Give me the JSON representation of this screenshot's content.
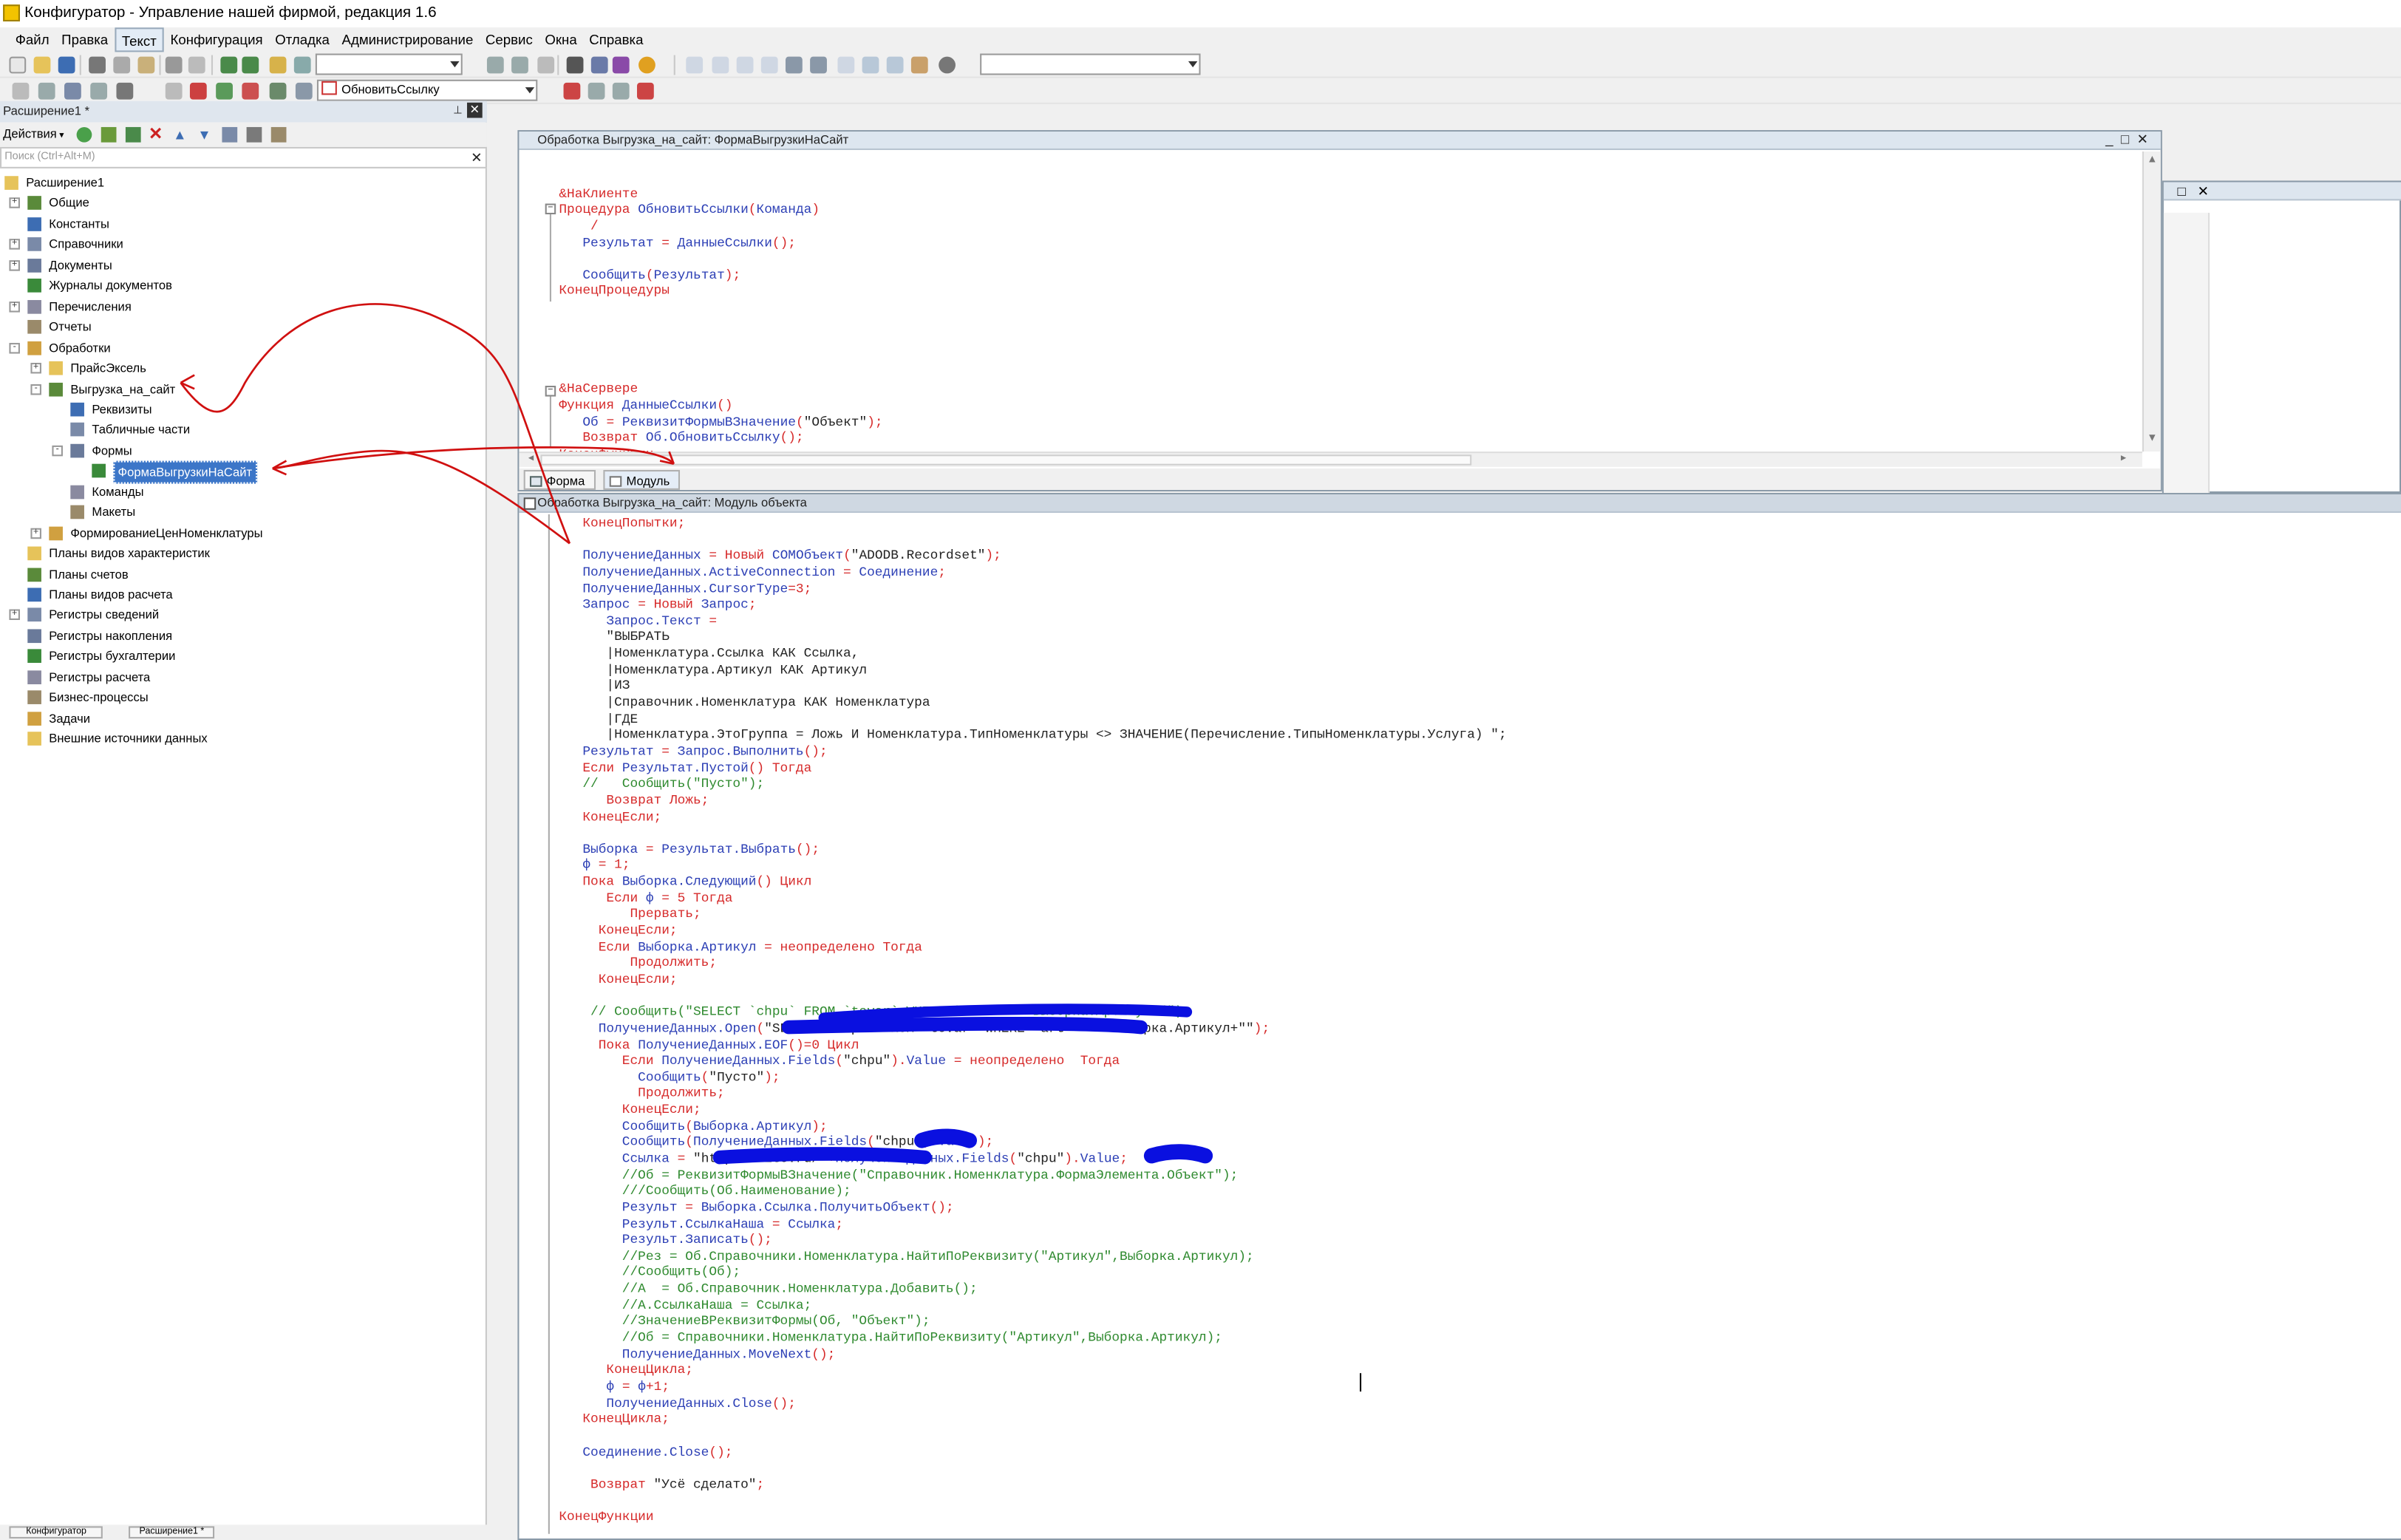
{
  "app": {
    "title": "Конфигуратор - Управление нашей фирмой, редакция 1.6",
    "window_controls": "_ □ ✕"
  },
  "menu": [
    "Файл",
    "Правка",
    "Текст",
    "Конфигурация",
    "Отладка",
    "Администрирование",
    "Сервис",
    "Окна",
    "Справка"
  ],
  "toolbar": {
    "proc_combo_value": "ОбновитьСсылку"
  },
  "panel": {
    "title": "Расширение1 *",
    "actions_label": "Действия",
    "search_placeholder": "Поиск (Ctrl+Alt+M)",
    "tree": [
      {
        "label": "Расширение1",
        "level": 0,
        "exp": "",
        "icon": "extension-icon"
      },
      {
        "label": "Общие",
        "level": 1,
        "exp": "+",
        "icon": "common-icon"
      },
      {
        "label": "Константы",
        "level": 1,
        "exp": "",
        "icon": "constants-icon"
      },
      {
        "label": "Справочники",
        "level": 1,
        "exp": "+",
        "icon": "catalogs-icon"
      },
      {
        "label": "Документы",
        "level": 1,
        "exp": "+",
        "icon": "documents-icon"
      },
      {
        "label": "Журналы документов",
        "level": 1,
        "exp": "",
        "icon": "journals-icon"
      },
      {
        "label": "Перечисления",
        "level": 1,
        "exp": "+",
        "icon": "enums-icon"
      },
      {
        "label": "Отчеты",
        "level": 1,
        "exp": "",
        "icon": "reports-icon"
      },
      {
        "label": "Обработки",
        "level": 1,
        "exp": "-",
        "icon": "processings-icon"
      },
      {
        "label": "ПрайсЭксель",
        "level": 2,
        "exp": "+",
        "icon": "processing-icon"
      },
      {
        "label": "Выгрузка_на_сайт",
        "level": 2,
        "exp": "-",
        "icon": "processing-icon"
      },
      {
        "label": "Реквизиты",
        "level": 3,
        "exp": "",
        "icon": "attributes-icon"
      },
      {
        "label": "Табличные части",
        "level": 3,
        "exp": "",
        "icon": "tabular-icon"
      },
      {
        "label": "Формы",
        "level": 3,
        "exp": "-",
        "icon": "forms-icon"
      },
      {
        "label": "ФормаВыгрузкиНаСайт",
        "level": 4,
        "exp": "",
        "icon": "form-icon",
        "selected": true
      },
      {
        "label": "Команды",
        "level": 3,
        "exp": "",
        "icon": "commands-icon"
      },
      {
        "label": "Макеты",
        "level": 3,
        "exp": "",
        "icon": "templates-icon"
      },
      {
        "label": "ФормированиеЦенНоменклатуры",
        "level": 2,
        "exp": "+",
        "icon": "processing-icon"
      },
      {
        "label": "Планы видов характеристик",
        "level": 1,
        "exp": "",
        "icon": "chart-types-icon"
      },
      {
        "label": "Планы счетов",
        "level": 1,
        "exp": "",
        "icon": "accounts-icon"
      },
      {
        "label": "Планы видов расчета",
        "level": 1,
        "exp": "",
        "icon": "calc-types-icon"
      },
      {
        "label": "Регистры сведений",
        "level": 1,
        "exp": "+",
        "icon": "info-reg-icon"
      },
      {
        "label": "Регистры накопления",
        "level": 1,
        "exp": "",
        "icon": "accum-reg-icon"
      },
      {
        "label": "Регистры бухгалтерии",
        "level": 1,
        "exp": "",
        "icon": "acc-reg-icon"
      },
      {
        "label": "Регистры расчета",
        "level": 1,
        "exp": "",
        "icon": "calc-reg-icon"
      },
      {
        "label": "Бизнес-процессы",
        "level": 1,
        "exp": "",
        "icon": "bp-icon"
      },
      {
        "label": "Задачи",
        "level": 1,
        "exp": "",
        "icon": "tasks-icon"
      },
      {
        "label": "Внешние источники данных",
        "level": 1,
        "exp": "",
        "icon": "ext-sources-icon"
      }
    ]
  },
  "form_window": {
    "title": "Обработка Выгрузка_на_сайт: ФормаВыгрузкиНаСайт",
    "tabs": [
      "Форма",
      "Модуль"
    ],
    "lines": [
      [],
      [
        [
          "k",
          "&НаКлиенте"
        ]
      ],
      [
        [
          "k",
          "Процедура "
        ],
        [
          "i",
          "ОбновитьСсылки"
        ],
        [
          "k",
          "("
        ],
        [
          "i",
          "Команда"
        ],
        [
          "k",
          ")"
        ]
      ],
      [
        [
          "k",
          "    /"
        ]
      ],
      [
        [
          "i",
          "   Результат "
        ],
        [
          "k",
          "= "
        ],
        [
          "i",
          "ДанныеСсылки"
        ],
        [
          "k",
          "();"
        ]
      ],
      [],
      [
        [
          "i",
          "   Сообщить"
        ],
        [
          "k",
          "("
        ],
        [
          "i",
          "Результат"
        ],
        [
          "k",
          ");"
        ]
      ],
      [
        [
          "k",
          "КонецПроцедуры"
        ]
      ],
      [],
      [],
      [],
      [],
      [],
      [
        [
          "k",
          "&НаСервере"
        ]
      ],
      [
        [
          "k",
          "Функция "
        ],
        [
          "i",
          "ДанныеСсылки"
        ],
        [
          "k",
          "()"
        ]
      ],
      [
        [
          "i",
          "   Об "
        ],
        [
          "k",
          "= "
        ],
        [
          "i",
          "РеквизитФормыВЗначение"
        ],
        [
          "k",
          "("
        ],
        [
          "s",
          "\"Объект\""
        ],
        [
          "k",
          ");"
        ]
      ],
      [
        [
          "k",
          "   Возврат "
        ],
        [
          "i",
          "Об.ОбновитьСсылку"
        ],
        [
          "k",
          "();"
        ]
      ],
      [
        [
          "k",
          "КонецФункции"
        ]
      ]
    ]
  },
  "module_window": {
    "title": "Обработка Выгрузка_на_сайт: Модуль объекта",
    "lines": [
      [
        [
          "k",
          "   КонецПопытки;"
        ]
      ],
      [],
      [
        [
          "i",
          "   ПолучениеДанных "
        ],
        [
          "k",
          "= Новый "
        ],
        [
          "i",
          "COMОбъект"
        ],
        [
          "k",
          "("
        ],
        [
          "s",
          "\"ADODB.Recordset\""
        ],
        [
          "k",
          ");"
        ]
      ],
      [
        [
          "i",
          "   ПолучениеДанных.ActiveConnection "
        ],
        [
          "k",
          "= "
        ],
        [
          "i",
          "Соединение"
        ],
        [
          "k",
          ";"
        ]
      ],
      [
        [
          "i",
          "   ПолучениеДанных.CursorType"
        ],
        [
          "k",
          "=3;"
        ]
      ],
      [
        [
          "i",
          "   Запрос "
        ],
        [
          "k",
          "= Новый "
        ],
        [
          "i",
          "Запрос"
        ],
        [
          "k",
          ";"
        ]
      ],
      [
        [
          "i",
          "      Запрос.Текст "
        ],
        [
          "k",
          "="
        ]
      ],
      [
        [
          "s",
          "      \"ВЫБРАТЬ"
        ]
      ],
      [
        [
          "s",
          "      |Номенклатура.Ссылка КАК Ссылка,"
        ]
      ],
      [
        [
          "s",
          "      |Номенклатура.Артикул КАК Артикул"
        ]
      ],
      [
        [
          "s",
          "      |ИЗ"
        ]
      ],
      [
        [
          "s",
          "      |Справочник.Номенклатура КАК Номенклатура"
        ]
      ],
      [
        [
          "s",
          "      |ГДЕ"
        ]
      ],
      [
        [
          "s",
          "      |Номенклатура.ЭтоГруппа = Ложь И Номенклатура.ТипНоменклатуры <> ЗНАЧЕНИЕ(Перечисление.ТипыНоменклатуры.Услуга) \";"
        ]
      ],
      [
        [
          "i",
          "   Результат "
        ],
        [
          "k",
          "= "
        ],
        [
          "i",
          "Запрос.Выполнить"
        ],
        [
          "k",
          "();"
        ]
      ],
      [
        [
          "k",
          "   Если "
        ],
        [
          "i",
          "Результат.Пустой"
        ],
        [
          "k",
          "() Тогда"
        ]
      ],
      [
        [
          "c",
          "   //   Сообщить(\"Пусто\");"
        ]
      ],
      [
        [
          "k",
          "      Возврат Ложь;"
        ]
      ],
      [
        [
          "k",
          "   КонецЕсли;"
        ]
      ],
      [],
      [
        [
          "i",
          "   Выборка "
        ],
        [
          "k",
          "= "
        ],
        [
          "i",
          "Результат.Выбрать"
        ],
        [
          "k",
          "();"
        ]
      ],
      [
        [
          "i",
          "   ф "
        ],
        [
          "k",
          "= 1;"
        ]
      ],
      [
        [
          "k",
          "   Пока "
        ],
        [
          "i",
          "Выборка.Следующий"
        ],
        [
          "k",
          "() Цикл"
        ]
      ],
      [
        [
          "k",
          "      Если "
        ],
        [
          "i",
          "ф "
        ],
        [
          "k",
          "= 5 Тогда"
        ]
      ],
      [
        [
          "k",
          "         Прервать;"
        ]
      ],
      [
        [
          "k",
          "     КонецЕсли;"
        ]
      ],
      [
        [
          "k",
          "     Если "
        ],
        [
          "i",
          "Выборка.Артикул "
        ],
        [
          "k",
          "= неопределено Тогда"
        ]
      ],
      [
        [
          "k",
          "         Продолжить;"
        ]
      ],
      [
        [
          "k",
          "     КонецЕсли;"
        ]
      ],
      [],
      [
        [
          "c",
          "    // Сообщить(\"SELECT `chpu` FROM `tovar` WHERE `art` = \"+Выборка.Артикул+\"\");"
        ]
      ],
      [
        [
          "i",
          "     ПолучениеДанных.Open"
        ],
        [
          "k",
          "("
        ],
        [
          "s",
          "\"SELECT `chpu` FROM `tovar` WHERE `art` = \"+Выборка.Артикул+\"\""
        ],
        [
          "k",
          ");"
        ]
      ],
      [
        [
          "k",
          "     Пока "
        ],
        [
          "i",
          "ПолучениеДанных.EOF"
        ],
        [
          "k",
          "()=0 Цикл"
        ]
      ],
      [
        [
          "k",
          "        Если "
        ],
        [
          "i",
          "ПолучениеДанных.Fields"
        ],
        [
          "k",
          "("
        ],
        [
          "s",
          "\"chpu\""
        ],
        [
          "k",
          ")."
        ],
        [
          "i",
          "Value "
        ],
        [
          "k",
          "= неопределено  Тогда"
        ]
      ],
      [
        [
          "i",
          "          Сообщить"
        ],
        [
          "k",
          "("
        ],
        [
          "s",
          "\"Пусто\""
        ],
        [
          "k",
          ");"
        ]
      ],
      [
        [
          "k",
          "          Продолжить;"
        ]
      ],
      [
        [
          "k",
          "        КонецЕсли;"
        ]
      ],
      [
        [
          "i",
          "        Сообщить"
        ],
        [
          "k",
          "("
        ],
        [
          "i",
          "Выборка.Артикул"
        ],
        [
          "k",
          ");"
        ]
      ],
      [
        [
          "i",
          "        Сообщить"
        ],
        [
          "k",
          "("
        ],
        [
          "i",
          "ПолучениеДанных.Fields"
        ],
        [
          "k",
          "("
        ],
        [
          "s",
          "\"chpu\""
        ],
        [
          "k",
          ")."
        ],
        [
          "i",
          "Value"
        ],
        [
          "k",
          ");"
        ]
      ],
      [
        [
          "i",
          "        Ссылка "
        ],
        [
          "k",
          "= "
        ],
        [
          "s",
          "\"http://site.ru/\""
        ],
        [
          "k",
          "+"
        ],
        [
          "i",
          "ПолучениеДанных.Fields"
        ],
        [
          "k",
          "("
        ],
        [
          "s",
          "\"chpu\""
        ],
        [
          "k",
          ")."
        ],
        [
          "i",
          "Value"
        ],
        [
          "k",
          ";"
        ]
      ],
      [
        [
          "c",
          "        //Об = РеквизитФормыВЗначение(\"Справочник.Номенклатура.ФормаЭлемента.Объект\");"
        ]
      ],
      [
        [
          "c",
          "        ///Сообщить(Об.Наименование);"
        ]
      ],
      [
        [
          "i",
          "        Результ "
        ],
        [
          "k",
          "= "
        ],
        [
          "i",
          "Выборка.Ссылка.ПолучитьОбъект"
        ],
        [
          "k",
          "();"
        ]
      ],
      [
        [
          "i",
          "        Результ.СсылкаНаша "
        ],
        [
          "k",
          "= "
        ],
        [
          "i",
          "Ссылка"
        ],
        [
          "k",
          ";"
        ]
      ],
      [
        [
          "i",
          "        Результ.Записать"
        ],
        [
          "k",
          "();"
        ]
      ],
      [
        [
          "c",
          "        //Рез = Об.Справочники.Номенклатура.НайтиПоРеквизиту(\"Артикул\",Выборка.Артикул);"
        ]
      ],
      [
        [
          "c",
          "        //Сообщить(Об);"
        ]
      ],
      [
        [
          "c",
          "        //А  = Об.Справочник.Номенклатура.Добавить();"
        ]
      ],
      [
        [
          "c",
          "        //А.СсылкаНаша = Ссылка;"
        ]
      ],
      [
        [
          "c",
          "        //ЗначениеВРеквизитФормы(Об, \"Объект\");"
        ]
      ],
      [
        [
          "c",
          "        //Об = Справочники.Номенклатура.НайтиПоРеквизиту(\"Артикул\",Выборка.Артикул);"
        ]
      ],
      [
        [
          "i",
          "        ПолучениеДанных.MoveNext"
        ],
        [
          "k",
          "();"
        ]
      ],
      [
        [
          "k",
          "      КонецЦикла;"
        ]
      ],
      [
        [
          "i",
          "      ф "
        ],
        [
          "k",
          "= "
        ],
        [
          "i",
          "ф"
        ],
        [
          "k",
          "+1;"
        ]
      ],
      [
        [
          "i",
          "      ПолучениеДанных.Close"
        ],
        [
          "k",
          "();"
        ]
      ],
      [
        [
          "k",
          "   КонецЦикла;"
        ]
      ],
      [],
      [
        [
          "i",
          "   Соединение.Close"
        ],
        [
          "k",
          "();"
        ]
      ],
      [],
      [
        [
          "k",
          "    Возврат "
        ],
        [
          "s",
          "\"Усё сделато\""
        ],
        [
          "k",
          ";"
        ]
      ],
      [],
      [
        [
          "k",
          "КонецФункции"
        ]
      ]
    ]
  },
  "taskbar": [
    "Конфигуратор",
    "Расширение1 *"
  ],
  "colors": {
    "keyword": "#d62a2a",
    "identifier": "#2c3fb5",
    "comment": "#2f8a2f",
    "selection": "#3c76c8",
    "annotation_arrow": "#d01010",
    "redaction": "#0a10e0"
  }
}
